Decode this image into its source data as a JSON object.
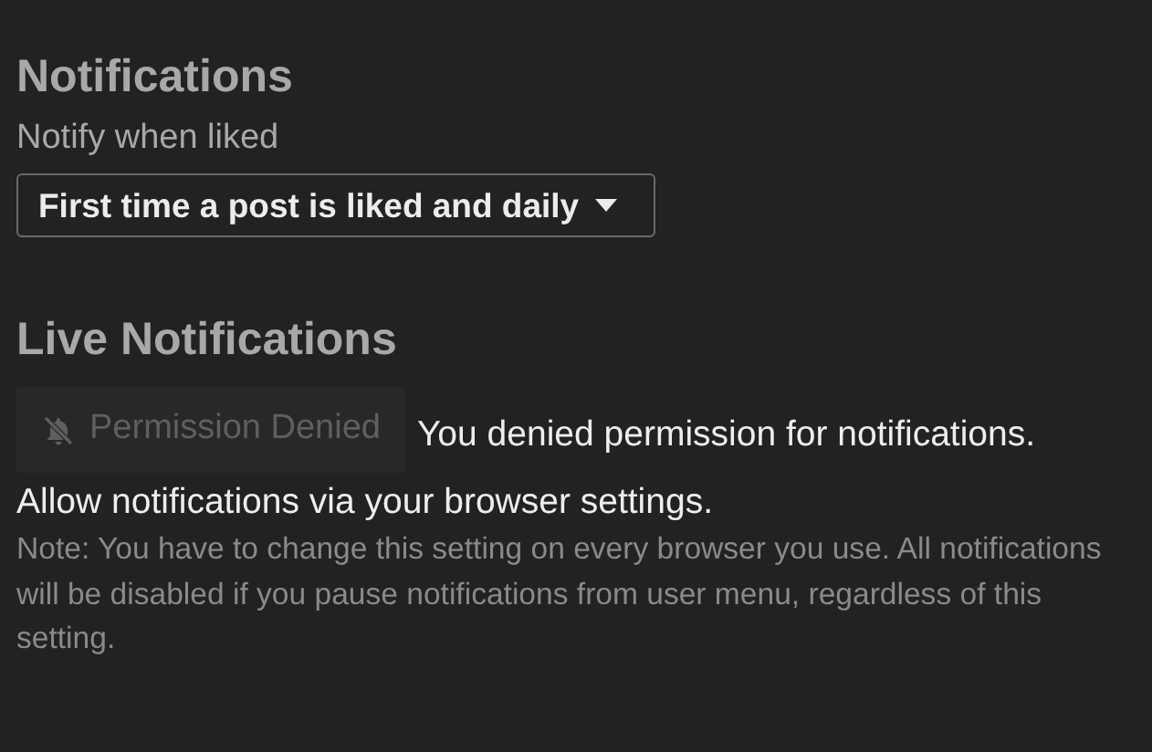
{
  "sections": [
    {
      "title": "Notifications",
      "settings": [
        {
          "kind": "select",
          "label": "Notify when liked",
          "value": "First time a post is liked and daily"
        }
      ]
    },
    {
      "title": "Live Notifications",
      "settings": [
        {
          "kind": "permission",
          "button": {
            "label": "Permission Denied",
            "disabled": true
          },
          "message_lines": [
            "You denied permission for notifications.",
            "Allow notifications via your browser settings."
          ],
          "note": "Note: You have to change this setting on every browser you use. All notifications will be disabled if you pause notifications from user menu, regardless of this setting."
        }
      ]
    }
  ]
}
